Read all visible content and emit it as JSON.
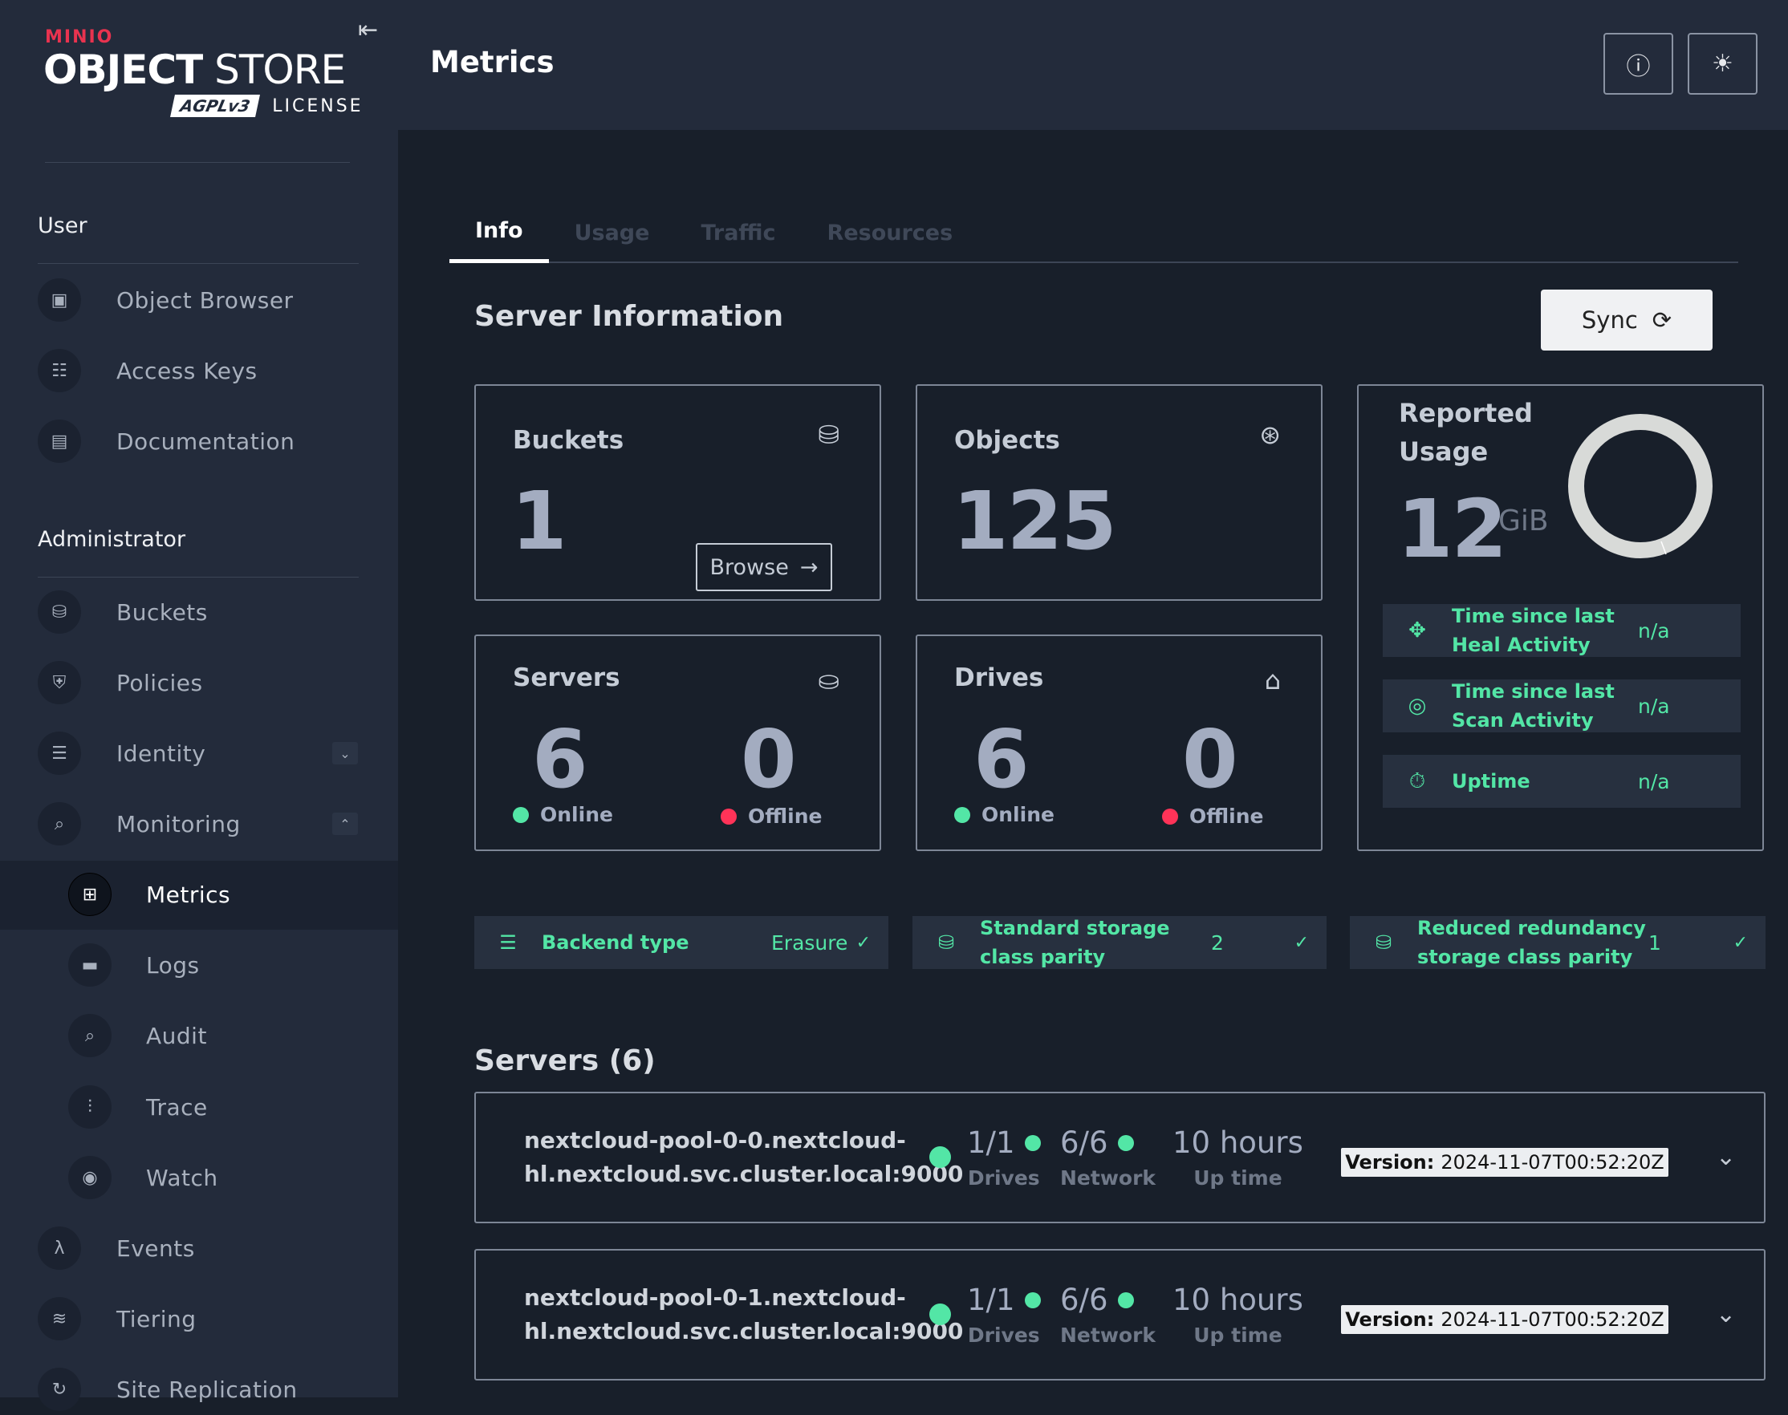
{
  "brand": {
    "vendor": "MINIO",
    "product_bold": "OBJECT",
    "product_light": "STORE",
    "license_badge": "AGPLv3",
    "license_label": "LICENSE"
  },
  "sidebar": {
    "user_section": "User",
    "user_items": [
      {
        "label": "Object Browser",
        "icon": "object-browser-icon"
      },
      {
        "label": "Access Keys",
        "icon": "access-keys-icon"
      },
      {
        "label": "Documentation",
        "icon": "documentation-icon"
      }
    ],
    "admin_section": "Administrator",
    "admin_items": [
      {
        "label": "Buckets"
      },
      {
        "label": "Policies"
      },
      {
        "label": "Identity",
        "expanded": false
      },
      {
        "label": "Monitoring",
        "expanded": true
      }
    ],
    "monitoring_items": [
      {
        "label": "Metrics",
        "active": true
      },
      {
        "label": "Logs"
      },
      {
        "label": "Audit"
      },
      {
        "label": "Trace"
      },
      {
        "label": "Watch"
      }
    ],
    "more_items": [
      {
        "label": "Events"
      },
      {
        "label": "Tiering"
      },
      {
        "label": "Site Replication"
      }
    ]
  },
  "header": {
    "title": "Metrics"
  },
  "tabs": [
    {
      "label": "Info",
      "active": true
    },
    {
      "label": "Usage"
    },
    {
      "label": "Traffic"
    },
    {
      "label": "Resources"
    }
  ],
  "server_info": {
    "title": "Server Information",
    "sync_label": "Sync",
    "buckets": {
      "title": "Buckets",
      "value": "1",
      "browse_label": "Browse"
    },
    "objects": {
      "title": "Objects",
      "value": "125"
    },
    "servers": {
      "title": "Servers",
      "online": "6",
      "online_label": "Online",
      "offline": "0",
      "offline_label": "Offline"
    },
    "drives": {
      "title": "Drives",
      "online": "6",
      "online_label": "Online",
      "offline": "0",
      "offline_label": "Offline"
    },
    "usage": {
      "title_line1": "Reported",
      "title_line2": "Usage",
      "value": "12",
      "unit": "GiB",
      "rows": [
        {
          "label1": "Time since last",
          "label2": "Heal Activity",
          "value": "n/a"
        },
        {
          "label1": "Time since last",
          "label2": "Scan Activity",
          "value": "n/a"
        },
        {
          "label1": "Uptime",
          "label2": "",
          "value": "n/a"
        }
      ]
    },
    "status": [
      {
        "label1": "Backend type",
        "label2": "",
        "value": "Erasure"
      },
      {
        "label1": "Standard storage",
        "label2": "class parity",
        "value": "2"
      },
      {
        "label1": "Reduced redundancy",
        "label2": "storage class parity",
        "value": "1"
      }
    ]
  },
  "servers_section": {
    "title": "Servers (6)",
    "items": [
      {
        "host1": "nextcloud-pool-0-0.nextcloud-",
        "host2": "hl.nextcloud.svc.cluster.local:9000",
        "drives": "1/1",
        "drives_label": "Drives",
        "network": "6/6",
        "network_label": "Network",
        "uptime": "10 hours",
        "uptime_label": "Up time",
        "version_label": "Version:",
        "version": "2024-11-07T00:52:20Z"
      },
      {
        "host1": "nextcloud-pool-0-1.nextcloud-",
        "host2": "hl.nextcloud.svc.cluster.local:9000",
        "drives": "1/1",
        "drives_label": "Drives",
        "network": "6/6",
        "network_label": "Network",
        "uptime": "10 hours",
        "uptime_label": "Up time",
        "version_label": "Version:",
        "version": "2024-11-07T00:52:20Z"
      }
    ]
  },
  "colors": {
    "ok": "#53e6a6",
    "error": "#ff3358",
    "brand": "#e9334f"
  }
}
